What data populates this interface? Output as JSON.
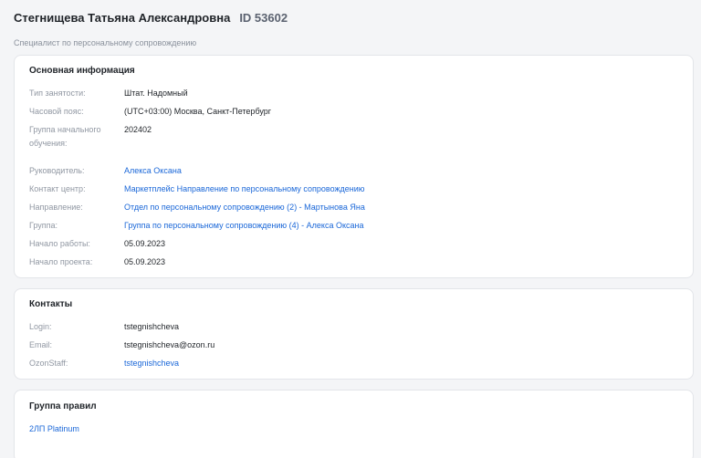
{
  "profile": {
    "name": "Стегнищева Татьяна Александровна",
    "id_label": "ID 53602",
    "subtitle": "Специалист по персональному сопровождению"
  },
  "basic_info": {
    "title": "Основная информация",
    "employment_type": {
      "label": "Тип занятости:",
      "value": "Штат. Надомный"
    },
    "timezone": {
      "label": "Часовой пояс:",
      "value": "(UTC+03:00) Москва, Санкт-Петербург"
    },
    "training_group": {
      "label_line1": "Группа начального",
      "label_line2": "обучения:",
      "value": "202402"
    },
    "manager": {
      "label": "Руководитель:",
      "value": "Алекса Оксана"
    },
    "contact_center": {
      "label": "Контакт центр:",
      "value": "Маркетплейс Направление по персональному сопровождению"
    },
    "direction": {
      "label": "Направление:",
      "value": "Отдел по персональному сопровождению (2) - Мартынова Яна"
    },
    "group": {
      "label": "Группа:",
      "value": "Группа по персональному сопровождению (4) - Алекса Оксана"
    },
    "work_start": {
      "label": "Начало работы:",
      "value": "05.09.2023"
    },
    "project_start": {
      "label": "Начало проекта:",
      "value": "05.09.2023"
    }
  },
  "contacts": {
    "title": "Контакты",
    "login": {
      "label": "Login:",
      "value": "tstegnishcheva"
    },
    "email": {
      "label": "Email:",
      "value": "tstegnishcheva@ozon.ru"
    },
    "ozonstaff": {
      "label": "OzonStaff:",
      "value": "tstegnishcheva"
    }
  },
  "rules_group": {
    "title": "Группа правил",
    "value": "2ЛП Platinum"
  },
  "colors": {
    "link": "#1a67d8",
    "label": "#9097a2",
    "background": "#f4f5f7"
  }
}
